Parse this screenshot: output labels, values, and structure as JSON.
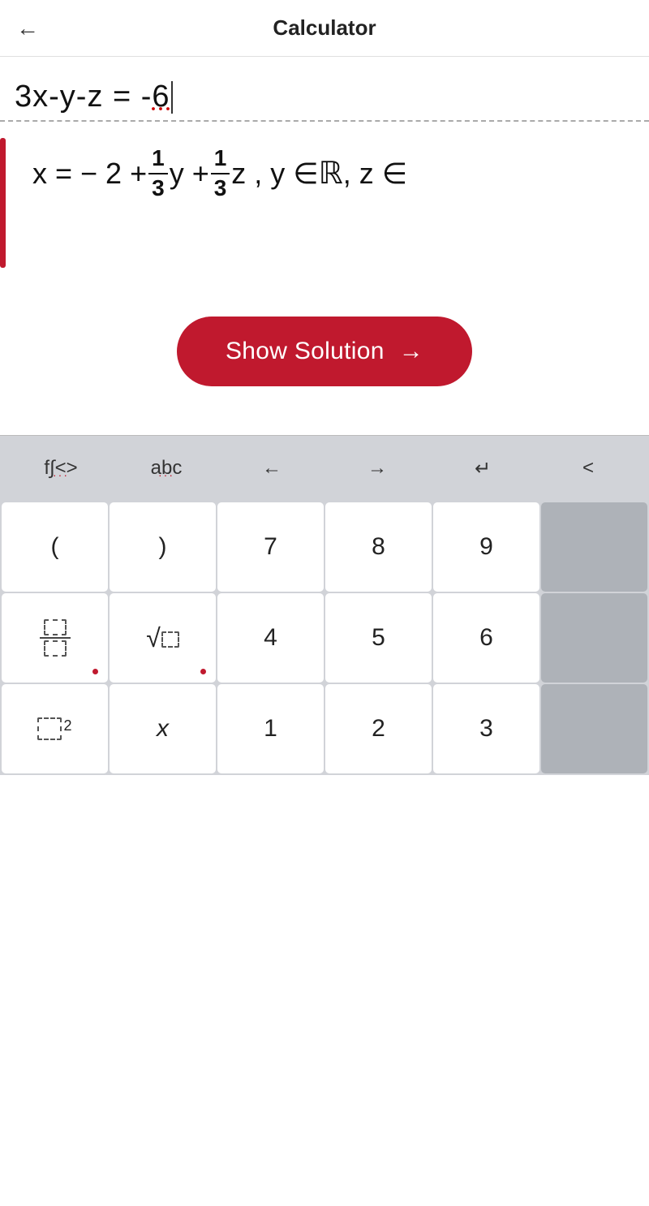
{
  "header": {
    "back_label": "←",
    "title": "Calculator"
  },
  "input": {
    "equation": "3x-y-z = -6"
  },
  "result": {
    "full_text": "x = − 2 + 1/3 y + 1/3 z , y ∈ ℝ , z ∈"
  },
  "button": {
    "show_solution": "Show Solution",
    "arrow": "→"
  },
  "keyboard": {
    "top_row": [
      {
        "label": "f∫<>",
        "dots": true
      },
      {
        "label": "abc",
        "dots": true
      },
      {
        "label": "←",
        "dots": false
      },
      {
        "label": "→",
        "dots": false
      },
      {
        "label": "↵",
        "dots": false
      },
      {
        "label": "<",
        "dots": false
      }
    ],
    "rows": [
      [
        {
          "label": "(",
          "type": "white"
        },
        {
          "label": ")",
          "type": "white"
        },
        {
          "label": "7",
          "type": "white"
        },
        {
          "label": "8",
          "type": "white"
        },
        {
          "label": "9",
          "type": "white"
        },
        {
          "label": "",
          "type": "gray"
        }
      ],
      [
        {
          "label": "frac",
          "type": "white",
          "icon": "frac"
        },
        {
          "label": "sqrt",
          "type": "white",
          "icon": "sqrt"
        },
        {
          "label": "4",
          "type": "white"
        },
        {
          "label": "5",
          "type": "white"
        },
        {
          "label": "6",
          "type": "white"
        },
        {
          "label": "",
          "type": "gray"
        }
      ],
      [
        {
          "label": "sq",
          "type": "white",
          "icon": "sq"
        },
        {
          "label": "x",
          "type": "white",
          "icon": "x"
        },
        {
          "label": "1",
          "type": "white"
        },
        {
          "label": "2",
          "type": "white"
        },
        {
          "label": "3",
          "type": "white"
        },
        {
          "label": "",
          "type": "gray"
        }
      ]
    ]
  }
}
